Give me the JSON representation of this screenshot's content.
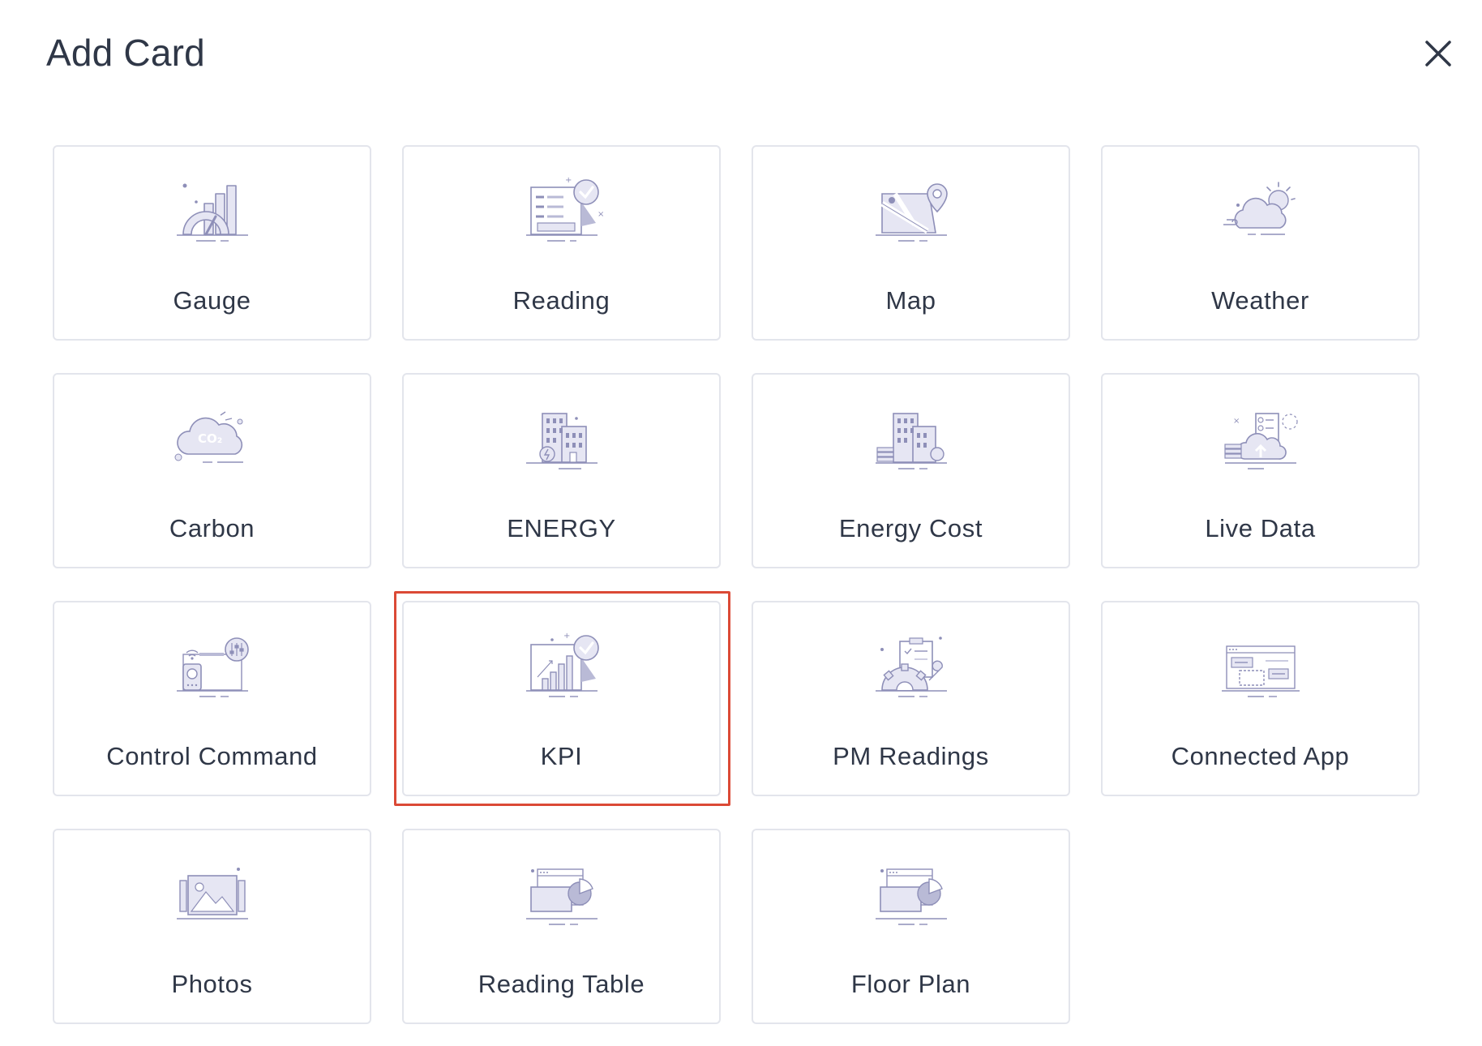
{
  "dialog": {
    "title": "Add Card",
    "close_icon": "close-icon"
  },
  "accent_colors": {
    "icon_stroke": "#8e8fb8",
    "icon_fill": "#e6e6f3",
    "selection_border": "#db4a36"
  },
  "cards": [
    {
      "label": "Gauge",
      "icon": "gauge-icon"
    },
    {
      "label": "Reading",
      "icon": "reading-icon"
    },
    {
      "label": "Map",
      "icon": "map-icon"
    },
    {
      "label": "Weather",
      "icon": "weather-icon"
    },
    {
      "label": "Carbon",
      "icon": "carbon-icon",
      "icon_text": "CO₂"
    },
    {
      "label": "ENERGY",
      "icon": "energy-icon"
    },
    {
      "label": "Energy Cost",
      "icon": "energy-cost-icon"
    },
    {
      "label": "Live Data",
      "icon": "live-data-icon"
    },
    {
      "label": "Control Command",
      "icon": "control-command-icon"
    },
    {
      "label": "KPI",
      "icon": "kpi-icon",
      "selected": true
    },
    {
      "label": "PM Readings",
      "icon": "pm-readings-icon"
    },
    {
      "label": "Connected App",
      "icon": "connected-app-icon"
    },
    {
      "label": "Photos",
      "icon": "photos-icon"
    },
    {
      "label": "Reading Table",
      "icon": "reading-table-icon"
    },
    {
      "label": "Floor Plan",
      "icon": "floor-plan-icon"
    }
  ]
}
